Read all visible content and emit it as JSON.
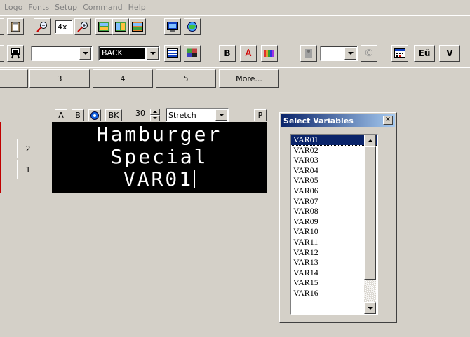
{
  "menu": [
    "Logo",
    "Fonts",
    "Setup",
    "Command",
    "Help"
  ],
  "toolbar1": {
    "zoom_value": "4x"
  },
  "toolbar2": {
    "color_combo_value": "",
    "background_combo_value": "BACK",
    "bold_label": "B",
    "font_color_label": "A",
    "size_combo_value": "",
    "charset_label": "Eü",
    "v_label": "V"
  },
  "page_tabs": [
    "3",
    "4",
    "5",
    "More..."
  ],
  "editor": {
    "align_a": "A",
    "align_b": "B",
    "bk_label": "BK",
    "speed_value": "30",
    "mode_value": "Stretch",
    "p_label": "P",
    "display_lines": [
      "Hamburger",
      "Special",
      "VAR01"
    ]
  },
  "line_buttons": [
    "2",
    "1"
  ],
  "select_variables": {
    "title": "Select Variables",
    "close_label": "×",
    "items": [
      "VAR01",
      "VAR02",
      "VAR03",
      "VAR04",
      "VAR05",
      "VAR06",
      "VAR07",
      "VAR08",
      "VAR09",
      "VAR10",
      "VAR11",
      "VAR12",
      "VAR13",
      "VAR14",
      "VAR15",
      "VAR16"
    ],
    "selected": "VAR01"
  },
  "colors": {
    "title_bar": "#0a246a",
    "face": "#d4d0c8",
    "display_bg": "#000000"
  }
}
